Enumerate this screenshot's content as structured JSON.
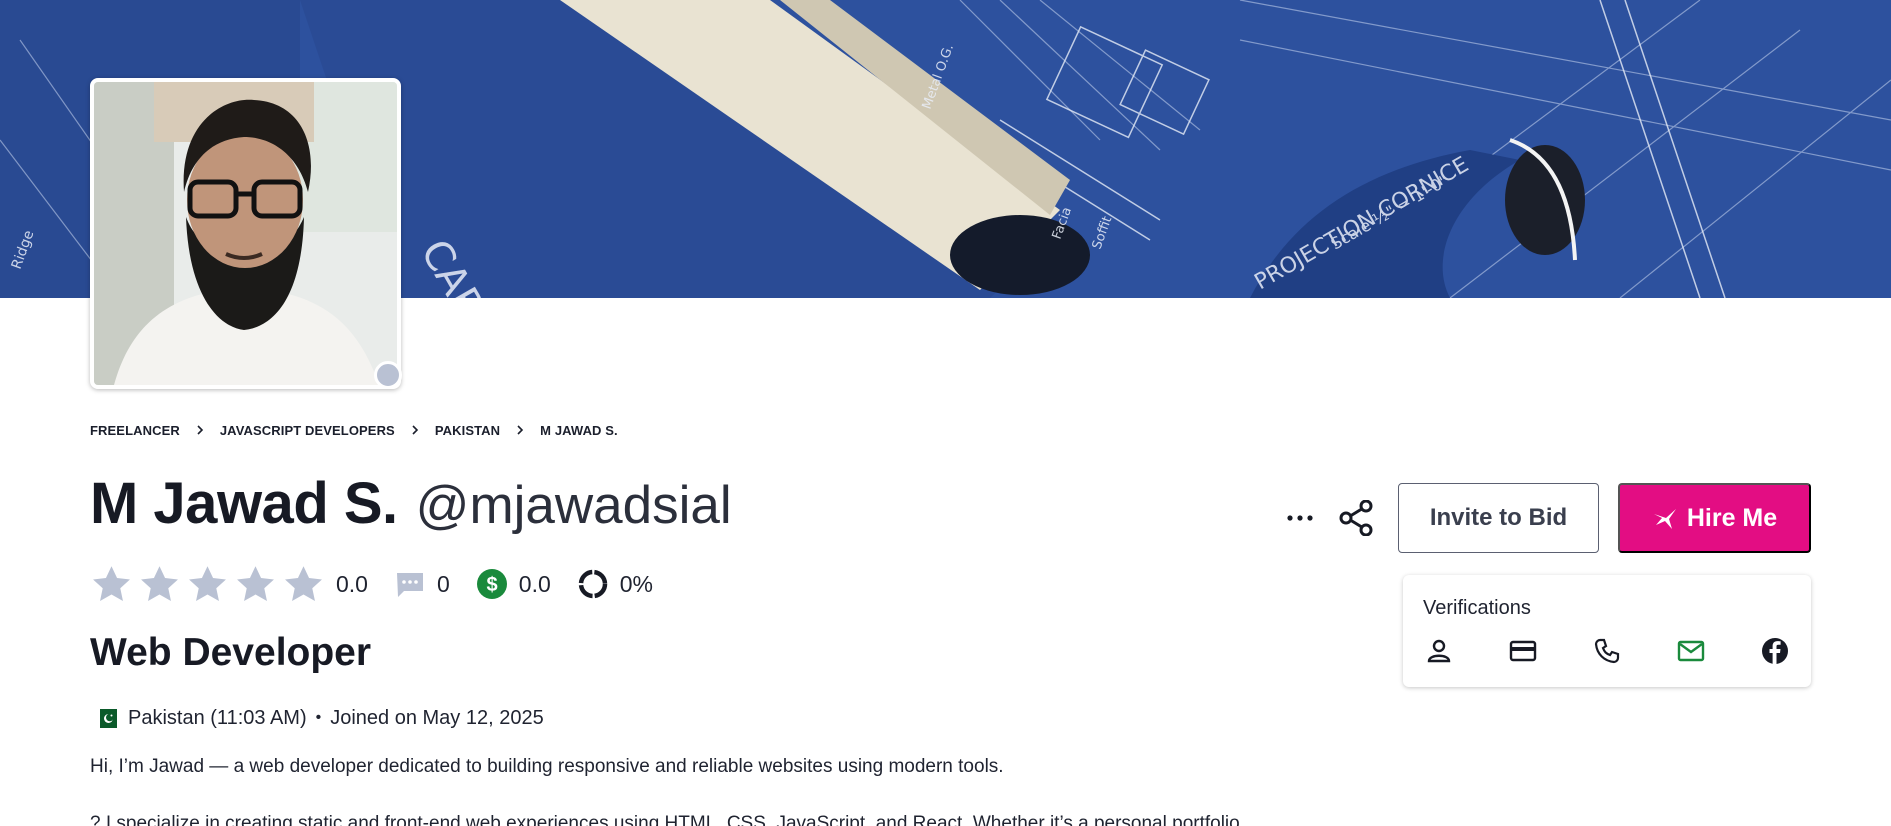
{
  "profile": {
    "display_name": "M Jawad S.",
    "username": "@mjawadsial",
    "online": false
  },
  "breadcrumb": [
    "FREELANCER",
    "JAVASCRIPT DEVELOPERS",
    "PAKISTAN",
    "M JAWAD S."
  ],
  "stats": {
    "rating": "0.0",
    "stars_filled": 0,
    "stars_total": 5,
    "reviews": "0",
    "earnings": "0.0",
    "completion": "0%"
  },
  "headline": "Web Developer",
  "location": {
    "country": "Pakistan (11:03 AM)",
    "joined": "Joined on May 12, 2025"
  },
  "bio": {
    "line1": "Hi, I’m Jawad — a web developer dedicated to building responsive and reliable websites using modern tools.",
    "line2": "? I specialize in creating static and front-end web experiences using HTML, CSS, JavaScript, and React. Whether it’s a personal portfolio"
  },
  "actions": {
    "invite": "Invite to Bid",
    "hire": "Hire Me"
  },
  "verifications": {
    "title": "Verifications",
    "items": [
      {
        "icon": "user-icon",
        "verified": false
      },
      {
        "icon": "credit-card-icon",
        "verified": false
      },
      {
        "icon": "phone-icon",
        "verified": false
      },
      {
        "icon": "email-icon",
        "verified": true
      },
      {
        "icon": "facebook-icon",
        "verified": false
      }
    ]
  },
  "colors": {
    "brand": "#e30d83",
    "verified": "#1a8a3c",
    "star_empty": "#b9c1d3",
    "earnings": "#1a8a3c"
  }
}
